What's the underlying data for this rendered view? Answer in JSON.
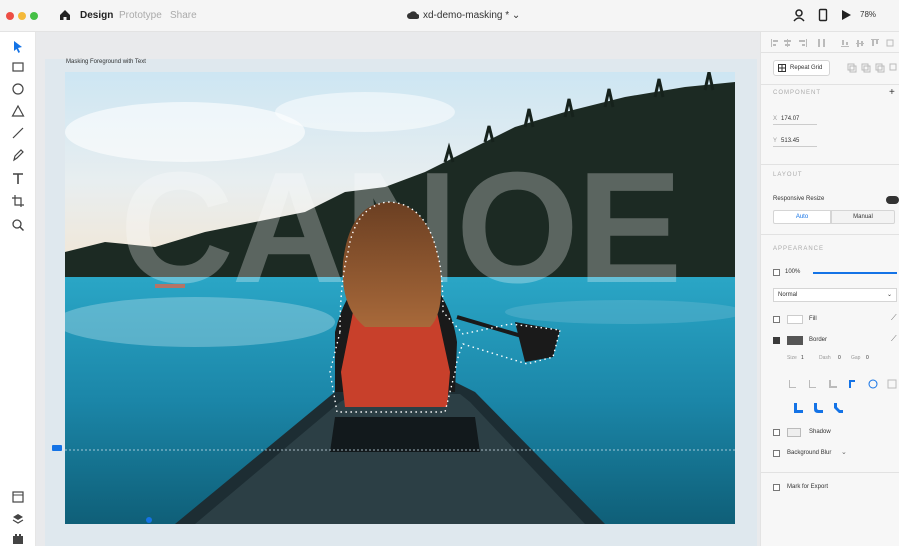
{
  "topbar": {
    "tabs": [
      "Design",
      "Prototype",
      "Share"
    ],
    "document_title": "xd-demo-masking * ⌄",
    "zoom": "78%",
    "icons": [
      "home-icon",
      "cloud-icon",
      "user-icon",
      "mobile-preview-icon",
      "play-icon"
    ]
  },
  "toolbar": {
    "tools": [
      "select-tool-icon",
      "rectangle-tool-icon",
      "ellipse-tool-icon",
      "polygon-tool-icon",
      "line-tool-icon",
      "pen-tool-icon",
      "text-tool-icon",
      "artboard-tool-icon",
      "zoom-tool-icon"
    ],
    "bottom": [
      "assets-icon",
      "layers-icon",
      "plugins-icon"
    ]
  },
  "canvas": {
    "artboard_label": "Masking Foreground with Text",
    "headline": "CANOE",
    "colors": {
      "water": "#1f8fb3",
      "sky": "#b9d9ea",
      "forest": "#1f2b26",
      "jacket": "#c8402b",
      "mask_path": "#ffffff"
    }
  },
  "panel": {
    "repeat_grid_label": "Repeat Grid",
    "component_title": "COMPONENT",
    "x_label": "X",
    "x_value": "174.07",
    "y_label": "Y",
    "y_value": "513.45",
    "layout_title": "LAYOUT",
    "responsive_resize_label": "Responsive Resize",
    "resize_options": [
      "Auto",
      "Manual"
    ],
    "appearance_title": "APPEARANCE",
    "opacity": "100%",
    "opacity_level": 1.0,
    "blend_mode": "Normal",
    "fill_label": "Fill",
    "border_label": "Border",
    "border_size_label": "Size",
    "border_size": "1",
    "border_dash_label": "Dash",
    "border_dash": "0",
    "border_gap_label": "Gap",
    "border_gap": "0",
    "shadow_label": "Shadow",
    "background_blur_label": "Background Blur",
    "mark_for_export_label": "Mark for Export",
    "accent_color": "#1473e6"
  }
}
